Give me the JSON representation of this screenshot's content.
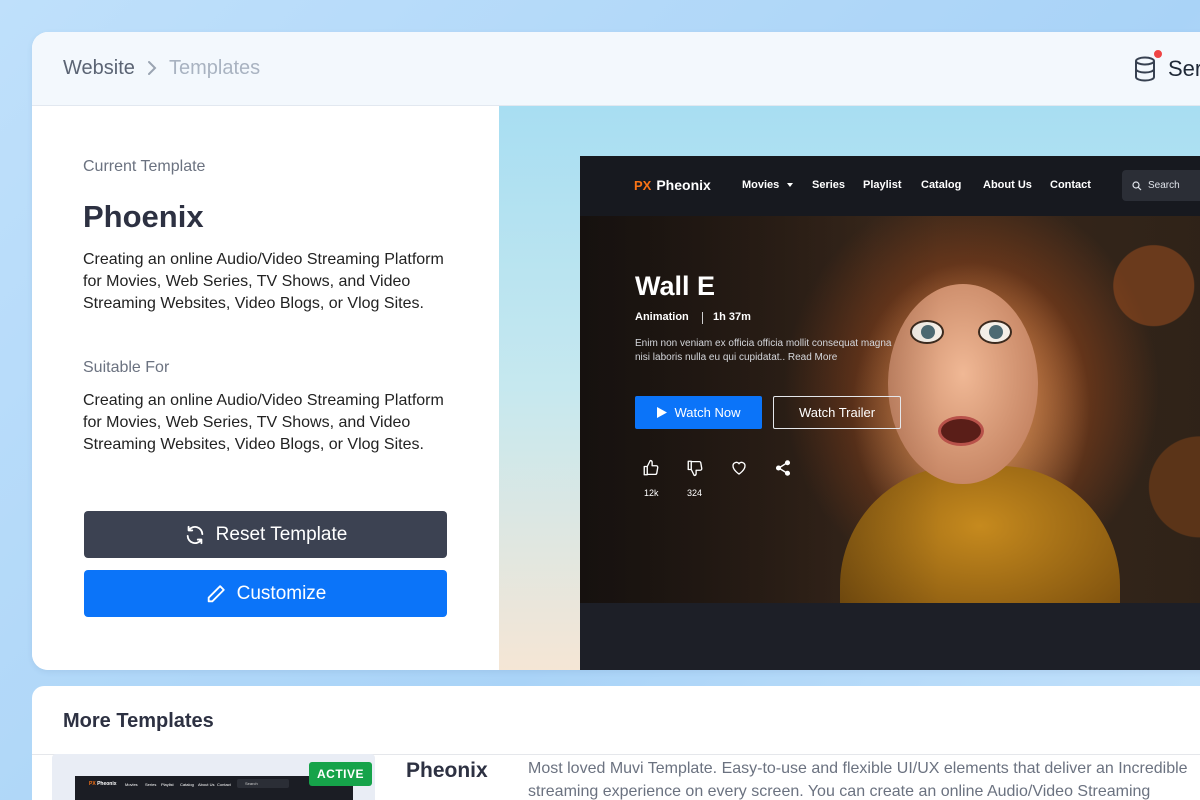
{
  "breadcrumb": [
    "Website",
    "Templates"
  ],
  "header": {
    "server_label": "Ser"
  },
  "current": {
    "label": "Current Template",
    "name": "Phoenix",
    "description": "Creating an online Audio/Video Streaming Platform for Movies, Web Series, TV Shows, and Video Streaming Websites, Video Blogs, or Vlog Sites.",
    "suitable_label": "Suitable For",
    "suitable_text": "Creating an online Audio/Video Streaming Platform for Movies, Web Series, TV Shows, and Video Streaming Websites, Video Blogs, or Vlog Sites.",
    "reset_label": "Reset Template",
    "customize_label": "Customize"
  },
  "preview": {
    "logo_mark": "PX",
    "logo_text": "Pheonix",
    "nav": [
      "Movies",
      "Series",
      "Playlist",
      "Catalog",
      "About Us",
      "Contact"
    ],
    "search_placeholder": "Search",
    "hero_title": "Wall E",
    "genre": "Animation",
    "duration": "1h 37m",
    "text": "Enim non veniam ex officia officia mollit consequat magna nisi laboris nulla eu qui cupidatat.. Read More",
    "watch_label": "Watch Now",
    "trailer_label": "Watch Trailer",
    "likes": "12k",
    "dislikes": "324"
  },
  "more": {
    "title": "More Templates",
    "card": {
      "name": "Pheonix",
      "badge": "ACTIVE",
      "description": "Most loved Muvi Template. Easy-to-use and flexible UI/UX elements that deliver an Incredible streaming experience on every screen. You can create an online Audio/Video Streaming",
      "thumb_logo": "Pheonix",
      "thumb_nav": [
        "Movies",
        "Series",
        "Playlist",
        "Catalog",
        "About Us",
        "Contact"
      ],
      "thumb_search": "Search"
    }
  },
  "colors": {
    "accent": "#0b74f9",
    "dark_button": "#3c4252",
    "active": "#16a34a",
    "notification": "#ef4444"
  }
}
